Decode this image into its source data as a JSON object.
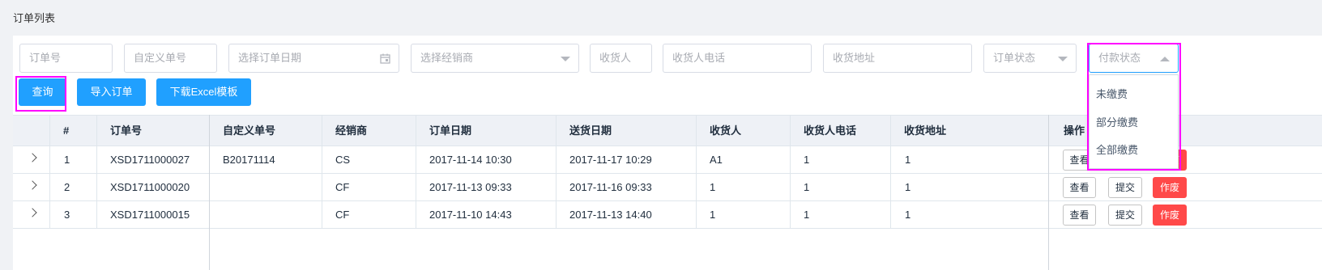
{
  "page_title": "订单列表",
  "filters": {
    "order_no": "订单号",
    "custom_no": "自定义单号",
    "order_date": "选择订单日期",
    "dealer": "选择经销商",
    "receiver": "收货人",
    "receiver_phone": "收货人电话",
    "receiver_address": "收货地址",
    "order_status": "订单状态",
    "payment_status": "付款状态"
  },
  "buttons": {
    "query": "查询",
    "import": "导入订单",
    "download": "下载Excel模板"
  },
  "table": {
    "headers": [
      "#",
      "订单号",
      "自定义单号",
      "经销商",
      "订单日期",
      "送货日期",
      "收货人",
      "收货人电话",
      "收货地址",
      "操作"
    ],
    "rows": [
      {
        "index": "1",
        "order_no": "XSD1711000027",
        "custom_no": "B20171114",
        "dealer": "CS",
        "order_date": "2017-11-14 10:30",
        "delivery_date": "2017-11-17 10:29",
        "receiver": "A1",
        "phone": "1",
        "address": "1"
      },
      {
        "index": "2",
        "order_no": "XSD1711000020",
        "custom_no": "",
        "dealer": "CF",
        "order_date": "2017-11-13 09:33",
        "delivery_date": "2017-11-16 09:33",
        "receiver": "1",
        "phone": "1",
        "address": "1"
      },
      {
        "index": "3",
        "order_no": "XSD1711000015",
        "custom_no": "",
        "dealer": "CF",
        "order_date": "2017-11-10 14:43",
        "delivery_date": "2017-11-13 14:40",
        "receiver": "1",
        "phone": "1",
        "address": "1"
      }
    ],
    "actions": {
      "view": "查看",
      "submit": "提交",
      "void": "作废"
    }
  },
  "payment_dropdown": {
    "options": [
      "未缴费",
      "部分缴费",
      "全部缴费"
    ]
  },
  "colors": {
    "primary": "#20a0ff",
    "danger": "#ff4949",
    "highlight": "#ff00ff"
  },
  "icons": {
    "date": "calendar-icon",
    "select": "chevron-down-icon",
    "open_select": "chevron-up-icon",
    "expand": "chevron-right-icon"
  }
}
